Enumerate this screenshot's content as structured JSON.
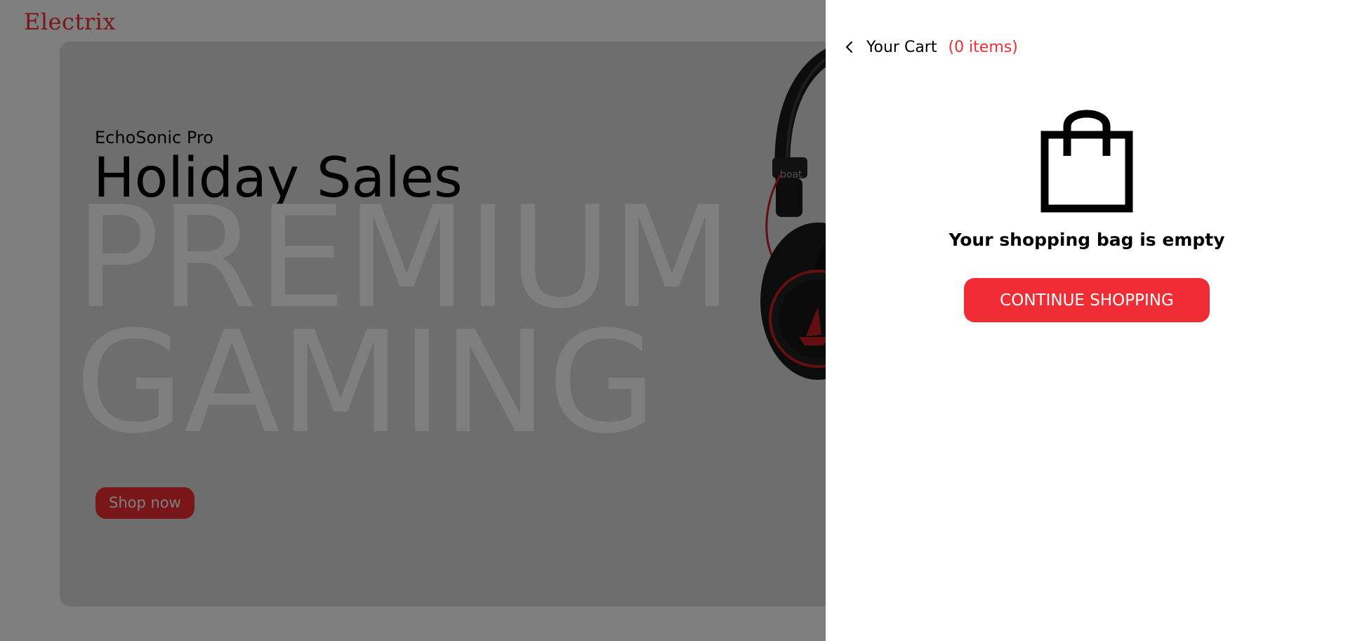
{
  "brand": {
    "logo": "Electrix"
  },
  "hero": {
    "subtitle": "EchoSonic Pro",
    "title": "Holiday Sales",
    "big_line_1": "PREMIUM",
    "big_line_2": "GAMING",
    "button_label": "Shop now",
    "product_brand_mark": "boat",
    "product_icon": "headphones-image"
  },
  "cart": {
    "back_icon": "chevron-left-icon",
    "title": "Your Cart",
    "count_text": "(0 items)",
    "empty_icon": "shopping-bag-icon",
    "empty_message": "Your shopping bag is empty",
    "continue_label": "CONTINUE SHOPPING"
  },
  "colors": {
    "accent": "#f02d34",
    "hero_background": "#dcdcdc",
    "overlay": "rgba(0,0,0,0.5)",
    "panel_background": "#ffffff"
  }
}
